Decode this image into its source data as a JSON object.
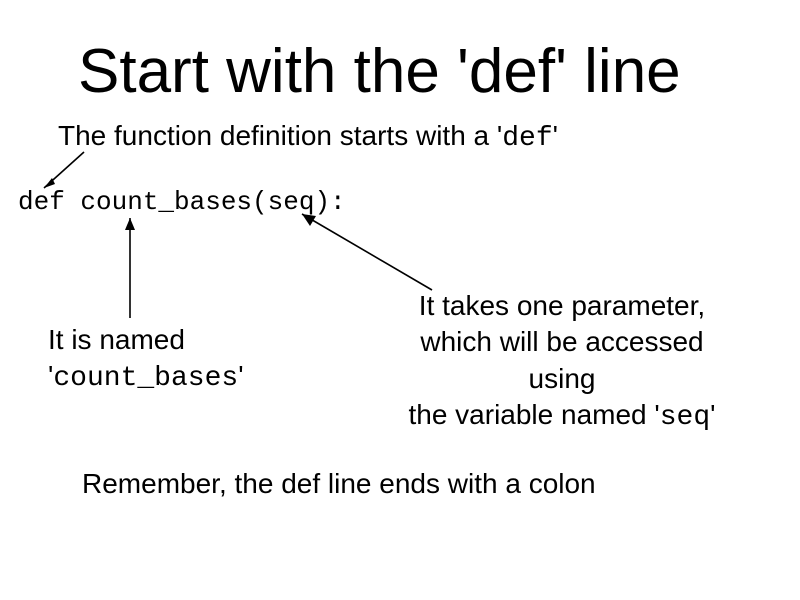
{
  "title": "Start with the 'def' line",
  "subtitle_prefix": "The function definition starts with a '",
  "subtitle_code": "def",
  "subtitle_suffix": "'",
  "code_line": "def count_bases(seq):",
  "label_named_line1": "It is named",
  "label_named_line2_prefix": "'",
  "label_named_line2_code": "count_bases",
  "label_named_line2_suffix": "'",
  "label_param_line1": "It takes one parameter,",
  "label_param_line2": "which will be accessed",
  "label_param_line3": "using",
  "label_param_line4_prefix": "the variable named '",
  "label_param_line4_code": "seq",
  "label_param_line4_suffix": "'",
  "footer": "Remember, the def line ends with a colon"
}
